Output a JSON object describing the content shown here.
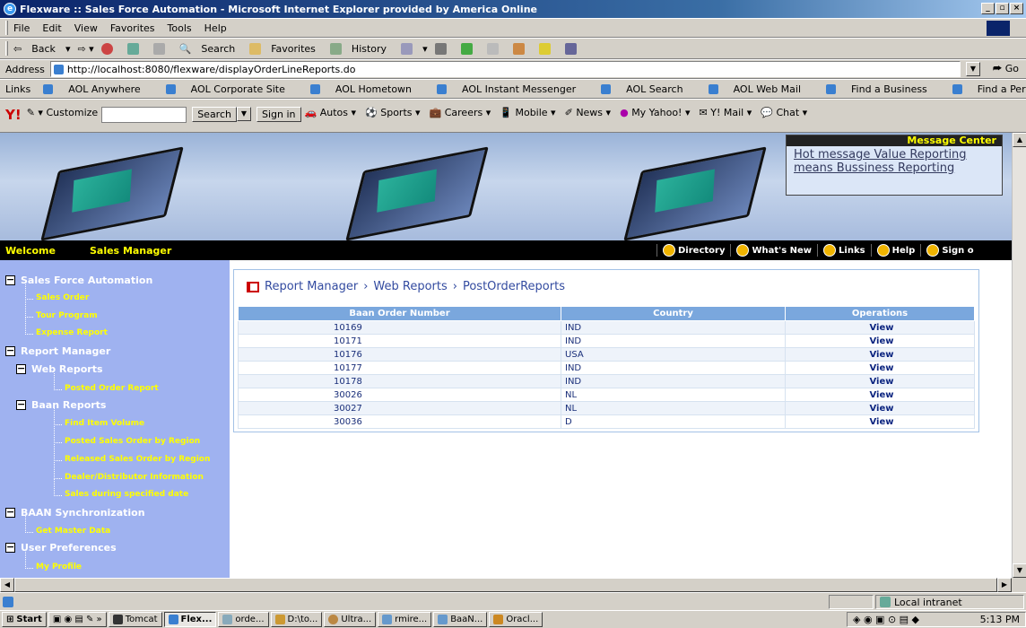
{
  "window": {
    "title": "Flexware :: Sales Force Automation - Microsoft Internet Explorer provided by America Online"
  },
  "menu": [
    "File",
    "Edit",
    "View",
    "Favorites",
    "Tools",
    "Help"
  ],
  "toolbar": {
    "back": "Back",
    "search": "Search",
    "favorites": "Favorites",
    "history": "History"
  },
  "address": {
    "label": "Address",
    "url": "http://localhost:8080/flexware/displayOrderLineReports.do",
    "go": "Go"
  },
  "links": {
    "label": "Links",
    "items": [
      "AOL Anywhere",
      "AOL Corporate Site",
      "AOL Hometown",
      "AOL Instant Messenger",
      "AOL Search",
      "AOL Web Mail",
      "Find a Business",
      "Find a Person"
    ]
  },
  "yahoo": {
    "customize": "Customize",
    "search": "Search",
    "signin": "Sign in",
    "items": [
      "Autos",
      "Sports",
      "Careers",
      "Mobile",
      "News",
      "My Yahoo!",
      "Y! Mail",
      "Chat"
    ]
  },
  "message_center": {
    "header": "Message Center",
    "text": "Hot message  Value Reporting means Bussiness Reporting"
  },
  "welcome": {
    "label": "Welcome",
    "role": "Sales Manager",
    "nav": [
      "Directory",
      "What's New",
      "Links",
      "Help",
      "Sign o"
    ]
  },
  "sidebar": {
    "sfa": "Sales Force Automation",
    "sales_order": "Sales Order",
    "tour_program": "Tour Program",
    "expense_report": "Expense Report",
    "report_manager": "Report Manager",
    "web_reports": "Web Reports",
    "posted_order_report": "Posted Order Report",
    "baan_reports": "Baan Reports",
    "find_item_volume": "Find Item Volume",
    "posted_sales_region": "Posted Sales Order by Region",
    "released_sales_region": "Released Sales Order by Region",
    "dealer_info": "Dealer/Distributor Information",
    "sales_date": "Sales during specified date",
    "baan_sync": "BAAN Synchronization",
    "get_master": "Get Master Data",
    "user_prefs": "User Preferences",
    "my_profile": "My Profile"
  },
  "breadcrumb": {
    "a": "Report Manager",
    "b": "Web Reports",
    "c": "PostOrderReports"
  },
  "table": {
    "headers": [
      "Baan Order Number",
      "Country",
      "Operations"
    ],
    "rows": [
      [
        "10169",
        "IND",
        "View"
      ],
      [
        "10171",
        "IND",
        "View"
      ],
      [
        "10176",
        "USA",
        "View"
      ],
      [
        "10177",
        "IND",
        "View"
      ],
      [
        "10178",
        "IND",
        "View"
      ],
      [
        "30026",
        "NL",
        "View"
      ],
      [
        "30027",
        "NL",
        "View"
      ],
      [
        "30036",
        "D",
        "View"
      ]
    ]
  },
  "status": {
    "zone": "Local intranet"
  },
  "taskbar": {
    "start": "Start",
    "items": [
      "Tomcat",
      "Flex...",
      "orde...",
      "D:\\to...",
      "Ultra...",
      "rmire...",
      "BaaN...",
      "Oracl..."
    ],
    "time": "5:13 PM"
  }
}
